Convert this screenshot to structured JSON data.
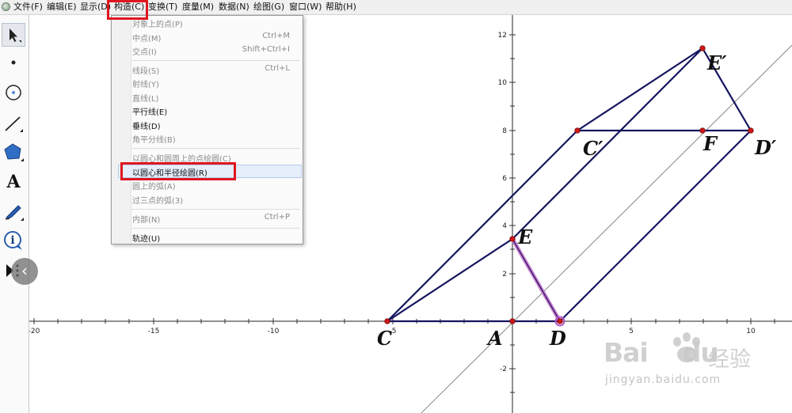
{
  "menubar": {
    "items": [
      "文件(F)",
      "编辑(E)",
      "显示(D)",
      "构造(C)",
      "变换(T)",
      "度量(M)",
      "数据(N)",
      "绘图(G)",
      "窗口(W)",
      "帮助(H)"
    ]
  },
  "construct_menu": {
    "items": [
      {
        "label": "对象上的点(P)",
        "shortcut": "",
        "enabled": false
      },
      {
        "label": "中点(M)",
        "shortcut": "Ctrl+M",
        "enabled": false
      },
      {
        "label": "交点(I)",
        "shortcut": "Shift+Ctrl+I",
        "enabled": false
      },
      {
        "label": "线段(S)",
        "shortcut": "Ctrl+L",
        "enabled": false
      },
      {
        "label": "射线(Y)",
        "shortcut": "",
        "enabled": false
      },
      {
        "label": "直线(L)",
        "shortcut": "",
        "enabled": false
      },
      {
        "label": "平行线(E)",
        "shortcut": "",
        "enabled": true
      },
      {
        "label": "垂线(D)",
        "shortcut": "",
        "enabled": true
      },
      {
        "label": "角平分线(B)",
        "shortcut": "",
        "enabled": false
      },
      {
        "label": "以圆心和圆周上的点绘圆(C)",
        "shortcut": "",
        "enabled": false
      },
      {
        "label": "以圆心和半径绘圆(R)",
        "shortcut": "",
        "enabled": true
      },
      {
        "label": "圆上的弧(A)",
        "shortcut": "",
        "enabled": false
      },
      {
        "label": "过三点的弧(3)",
        "shortcut": "",
        "enabled": false
      },
      {
        "label": "内部(N)",
        "shortcut": "Ctrl+P",
        "enabled": false
      },
      {
        "label": "轨迹(U)",
        "shortcut": "",
        "enabled": true
      }
    ]
  },
  "toolbar": {
    "tools": [
      "arrow-select",
      "point",
      "compass",
      "straightedge",
      "polygon",
      "text",
      "marker",
      "information",
      "custom-tools"
    ],
    "text_tool_glyph": "A",
    "info_tool_glyph": "i",
    "collapse_glyph": "‹"
  },
  "axes": {
    "x_ticks": [
      "-20",
      "-15",
      "-10",
      "-5",
      "5",
      "10"
    ],
    "y_ticks": [
      "12",
      "10",
      "8",
      "6",
      "4",
      "2",
      "-2"
    ]
  },
  "points": {
    "C": "C",
    "A": "A",
    "D": "D",
    "E": "E",
    "C_prime": "C′",
    "F": "F",
    "D_prime": "D′",
    "E_prime": "E′"
  },
  "colors": {
    "shape_stroke": "#15155f",
    "point_fill": "#cc1818",
    "highlight_segment": "#b05ac8",
    "annotation_red": "#e0161f"
  },
  "watermark": {
    "brand": "Bai",
    "brand_suffix": "du",
    "cn": "经验",
    "url": "jingyan.baidu.com"
  }
}
